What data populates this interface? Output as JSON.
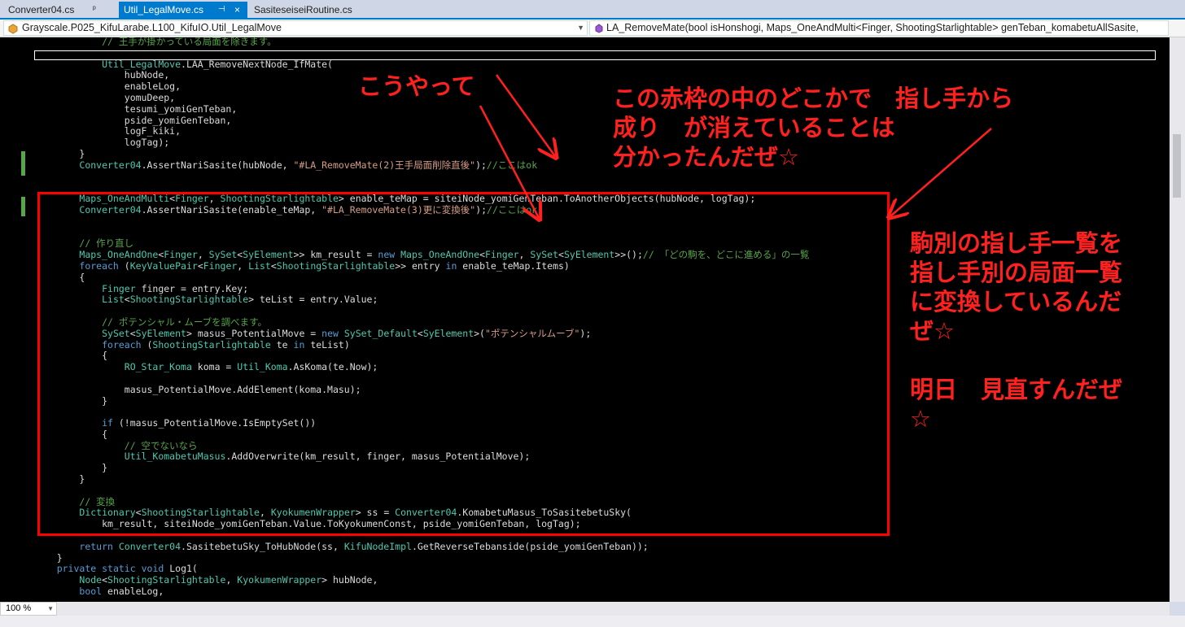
{
  "tabs": [
    {
      "label": "Converter04.cs",
      "pin": "ᵖ"
    },
    {
      "label": "Util_LegalMove.cs",
      "pin": "⊣",
      "close": "×"
    },
    {
      "label": "SasiteseiseiRoutine.cs"
    }
  ],
  "navbar": {
    "class_combo": "Grayscale.P025_KifuLarabe.L100_KifuIO.Util_LegalMove",
    "member_combo": "LA_RemoveMate(bool isHonshogi, Maps_OneAndMulti<Finger, ShootingStarlightable> genTeban_komabetuAllSasite,"
  },
  "code_lines": [
    [
      [
        "            ",
        ""
      ],
      [
        "// 王手が掛かっている局面を除きます。",
        "cm"
      ]
    ],
    [
      [
        "",
        ""
      ]
    ],
    [
      [
        "            ",
        ""
      ],
      [
        "Util_LegalMove",
        "ty"
      ],
      [
        ".LAA_RemoveNextNode_IfMate(",
        ""
      ]
    ],
    [
      [
        "                hubNode,",
        ""
      ]
    ],
    [
      [
        "                enableLog,",
        ""
      ]
    ],
    [
      [
        "                yomuDeep,",
        ""
      ]
    ],
    [
      [
        "                tesumi_yomiGenTeban,",
        ""
      ]
    ],
    [
      [
        "                pside_yomiGenTeban,",
        ""
      ]
    ],
    [
      [
        "                logF_kiki,",
        ""
      ]
    ],
    [
      [
        "                logTag);",
        ""
      ]
    ],
    [
      [
        "        }",
        ""
      ]
    ],
    [
      [
        "        ",
        ""
      ],
      [
        "Converter04",
        "ty"
      ],
      [
        ".AssertNariSasite(hubNode, ",
        ""
      ],
      [
        "\"#LA_RemoveMate(2)王手局面削除直後\"",
        "st"
      ],
      [
        ");",
        ""
      ],
      [
        "//ここはok",
        "cm"
      ]
    ],
    [
      [
        "",
        ""
      ]
    ],
    [
      [
        "",
        ""
      ]
    ],
    [
      [
        "        ",
        ""
      ],
      [
        "Maps_OneAndMulti",
        "ty"
      ],
      [
        "<",
        ""
      ],
      [
        "Finger",
        "ty"
      ],
      [
        ", ",
        ""
      ],
      [
        "ShootingStarlightable",
        "ty"
      ],
      [
        "> enable_teMap = siteiNode_yomiGenTeban.ToAnotherObjects(hubNode, logTag);",
        ""
      ]
    ],
    [
      [
        "        ",
        ""
      ],
      [
        "Converter04",
        "ty"
      ],
      [
        ".AssertNariSasite(enable_teMap, ",
        ""
      ],
      [
        "\"#LA_RemoveMate(3)更に変換後\"",
        "st"
      ],
      [
        ");",
        ""
      ],
      [
        "//ここはok",
        "cm"
      ]
    ],
    [
      [
        "",
        ""
      ]
    ],
    [
      [
        "",
        ""
      ]
    ],
    [
      [
        "        ",
        ""
      ],
      [
        "// 作り直し",
        "cm"
      ]
    ],
    [
      [
        "        ",
        ""
      ],
      [
        "Maps_OneAndOne",
        "ty"
      ],
      [
        "<",
        ""
      ],
      [
        "Finger",
        "ty"
      ],
      [
        ", ",
        ""
      ],
      [
        "SySet",
        "ty"
      ],
      [
        "<",
        ""
      ],
      [
        "SyElement",
        "ty"
      ],
      [
        ">> km_result = ",
        ""
      ],
      [
        "new",
        "kw"
      ],
      [
        " ",
        ""
      ],
      [
        "Maps_OneAndOne",
        "ty"
      ],
      [
        "<",
        ""
      ],
      [
        "Finger",
        "ty"
      ],
      [
        ", ",
        ""
      ],
      [
        "SySet",
        "ty"
      ],
      [
        "<",
        ""
      ],
      [
        "SyElement",
        "ty"
      ],
      [
        ">>();",
        ""
      ],
      [
        "// 「どの駒を、どこに進める」の一覧",
        "cm"
      ]
    ],
    [
      [
        "        ",
        ""
      ],
      [
        "foreach",
        "kw"
      ],
      [
        " (",
        ""
      ],
      [
        "KeyValuePair",
        "ty"
      ],
      [
        "<",
        ""
      ],
      [
        "Finger",
        "ty"
      ],
      [
        ", ",
        ""
      ],
      [
        "List",
        "ty"
      ],
      [
        "<",
        ""
      ],
      [
        "ShootingStarlightable",
        "ty"
      ],
      [
        ">> entry ",
        ""
      ],
      [
        "in",
        "kw"
      ],
      [
        " enable_teMap.Items)",
        ""
      ]
    ],
    [
      [
        "        {",
        ""
      ]
    ],
    [
      [
        "            ",
        ""
      ],
      [
        "Finger",
        "ty"
      ],
      [
        " finger = entry.Key;",
        ""
      ]
    ],
    [
      [
        "            ",
        ""
      ],
      [
        "List",
        "ty"
      ],
      [
        "<",
        ""
      ],
      [
        "ShootingStarlightable",
        "ty"
      ],
      [
        "> teList = entry.Value;",
        ""
      ]
    ],
    [
      [
        "",
        ""
      ]
    ],
    [
      [
        "            ",
        ""
      ],
      [
        "// ポテンシャル・ムーブを調べます。",
        "cm"
      ]
    ],
    [
      [
        "            ",
        ""
      ],
      [
        "SySet",
        "ty"
      ],
      [
        "<",
        ""
      ],
      [
        "SyElement",
        "ty"
      ],
      [
        "> masus_PotentialMove = ",
        ""
      ],
      [
        "new",
        "kw"
      ],
      [
        " ",
        ""
      ],
      [
        "SySet_Default",
        "ty"
      ],
      [
        "<",
        ""
      ],
      [
        "SyElement",
        "ty"
      ],
      [
        ">(",
        ""
      ],
      [
        "\"ポテンシャルムーブ\"",
        "st"
      ],
      [
        ");",
        ""
      ]
    ],
    [
      [
        "            ",
        ""
      ],
      [
        "foreach",
        "kw"
      ],
      [
        " (",
        ""
      ],
      [
        "ShootingStarlightable",
        "ty"
      ],
      [
        " te ",
        ""
      ],
      [
        "in",
        "kw"
      ],
      [
        " teList)",
        ""
      ]
    ],
    [
      [
        "            {",
        ""
      ]
    ],
    [
      [
        "                ",
        ""
      ],
      [
        "RO_Star_Koma",
        "ty"
      ],
      [
        " koma = ",
        ""
      ],
      [
        "Util_Koma",
        "ty"
      ],
      [
        ".AsKoma(te.Now);",
        ""
      ]
    ],
    [
      [
        "",
        ""
      ]
    ],
    [
      [
        "                masus_PotentialMove.AddElement(koma.Masu);",
        ""
      ]
    ],
    [
      [
        "            }",
        ""
      ]
    ],
    [
      [
        "",
        ""
      ]
    ],
    [
      [
        "            ",
        ""
      ],
      [
        "if",
        "kw"
      ],
      [
        " (!masus_PotentialMove.IsEmptySet())",
        ""
      ]
    ],
    [
      [
        "            {",
        ""
      ]
    ],
    [
      [
        "                ",
        ""
      ],
      [
        "// 空でないなら",
        "cm"
      ]
    ],
    [
      [
        "                ",
        ""
      ],
      [
        "Util_KomabetuMasus",
        "ty"
      ],
      [
        ".AddOverwrite(km_result, finger, masus_PotentialMove);",
        ""
      ]
    ],
    [
      [
        "            }",
        ""
      ]
    ],
    [
      [
        "        }",
        ""
      ]
    ],
    [
      [
        "",
        ""
      ]
    ],
    [
      [
        "        ",
        ""
      ],
      [
        "// 変換",
        "cm"
      ]
    ],
    [
      [
        "        ",
        ""
      ],
      [
        "Dictionary",
        "ty"
      ],
      [
        "<",
        ""
      ],
      [
        "ShootingStarlightable",
        "ty"
      ],
      [
        ", ",
        ""
      ],
      [
        "KyokumenWrapper",
        "ty"
      ],
      [
        "> ss = ",
        ""
      ],
      [
        "Converter04",
        "ty"
      ],
      [
        ".KomabetuMasus_ToSasitebetuSky(",
        ""
      ]
    ],
    [
      [
        "            km_result, siteiNode_yomiGenTeban.Value.ToKyokumenConst, pside_yomiGenTeban, logTag);",
        ""
      ]
    ],
    [
      [
        "",
        ""
      ]
    ],
    [
      [
        "        ",
        ""
      ],
      [
        "return",
        "kw"
      ],
      [
        " ",
        ""
      ],
      [
        "Converter04",
        "ty"
      ],
      [
        ".SasitebetuSky_ToHubNode(ss, ",
        ""
      ],
      [
        "KifuNodeImpl",
        "ty"
      ],
      [
        ".GetReverseTebanside(pside_yomiGenTeban));",
        ""
      ]
    ],
    [
      [
        "    }",
        ""
      ]
    ],
    [
      [
        "    ",
        ""
      ],
      [
        "private",
        "kw"
      ],
      [
        " ",
        ""
      ],
      [
        "static",
        "kw"
      ],
      [
        " ",
        ""
      ],
      [
        "void",
        "kw"
      ],
      [
        " Log1(",
        ""
      ]
    ],
    [
      [
        "        ",
        ""
      ],
      [
        "Node",
        "ty"
      ],
      [
        "<",
        ""
      ],
      [
        "ShootingStarlightable",
        "ty"
      ],
      [
        ", ",
        ""
      ],
      [
        "KyokumenWrapper",
        "ty"
      ],
      [
        "> hubNode,",
        ""
      ]
    ],
    [
      [
        "        ",
        ""
      ],
      [
        "bool",
        "kw"
      ],
      [
        " enableLog,",
        ""
      ]
    ]
  ],
  "annotations": {
    "left_top": "こうやって",
    "center_top": "この赤枠の中のどこかで　指し手から\n成り　が消えていることは\n分かったんだぜ☆",
    "right_side": "駒別の指し手一覧を\n指し手別の局面一覧\nに変換しているんだ\nぜ☆\n\n明日　見直すんだぜ\n☆"
  },
  "zoom": "100 %",
  "colors": {
    "accent": "#007acc",
    "annotation": "#ff2020",
    "comment": "#57a64a",
    "type": "#4ec9b0",
    "keyword": "#569cd6",
    "string": "#d69d85"
  }
}
